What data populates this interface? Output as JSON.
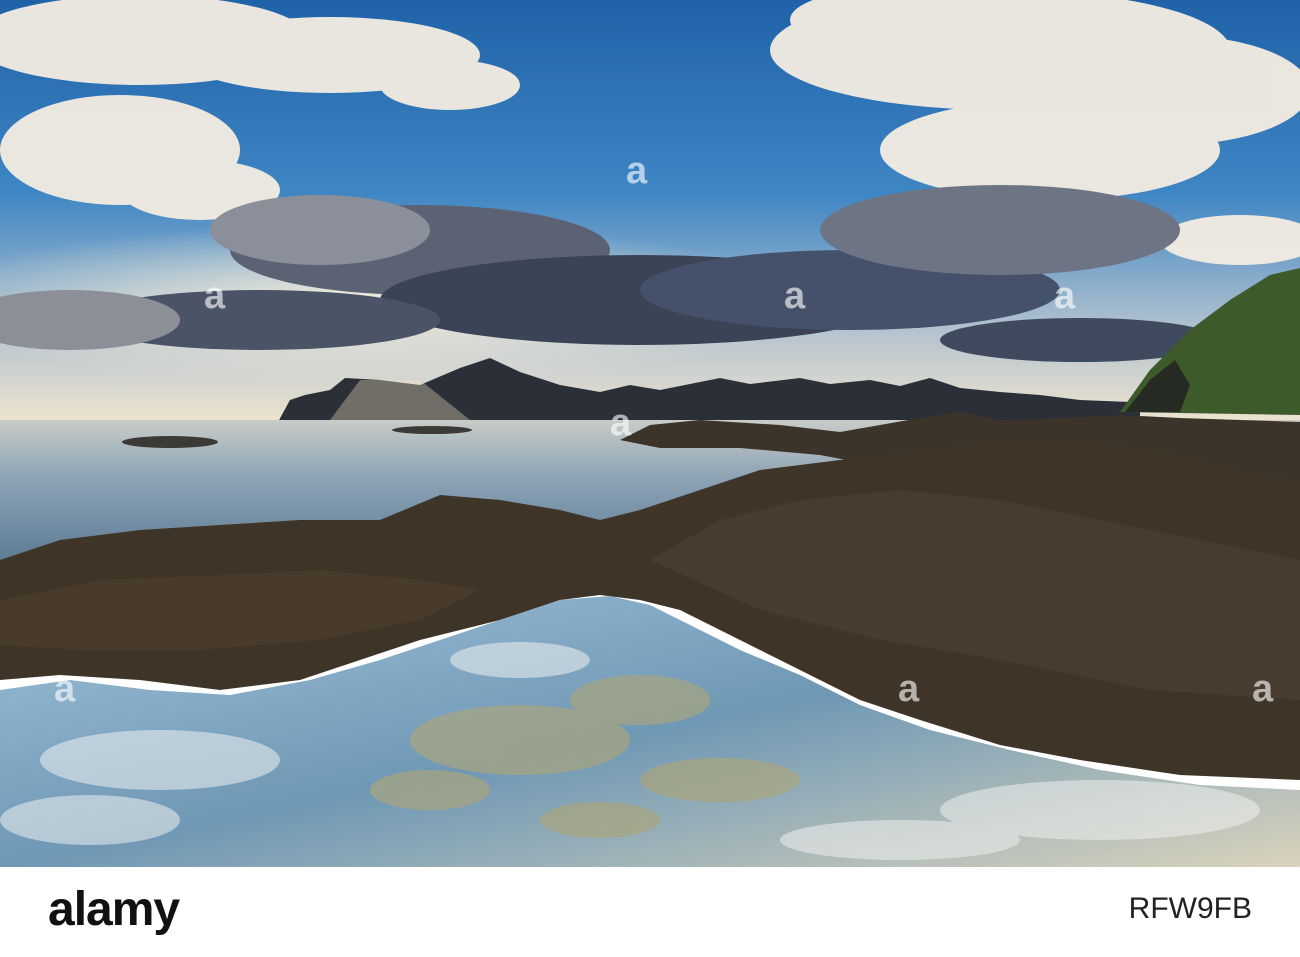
{
  "photo": {
    "subject": "coastal tide pool landscape"
  },
  "watermark": {
    "text": "alamy"
  },
  "footer": {
    "brand": "alamy",
    "image_id": "RFW9FB"
  },
  "colors": {
    "sky_top": "#2a6fb3",
    "sky_horizon": "#f3e6d0",
    "sea": "#7d98b0",
    "rock": "#3d3326",
    "pool": "#8fb0c9"
  }
}
